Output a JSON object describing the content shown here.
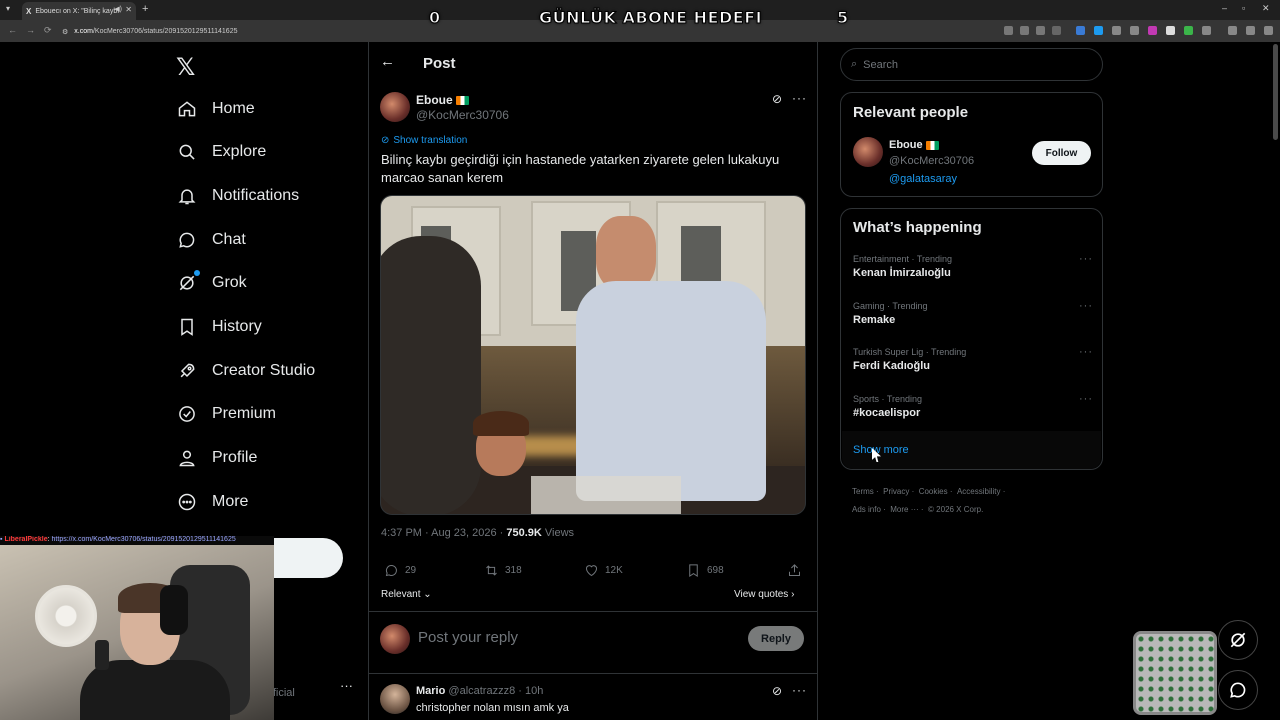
{
  "browser": {
    "tab_title": "Ebouecı on X: \"Bilinç kaybı",
    "new_tab": "+",
    "url_host": "x.com",
    "url_path": "/KocMerc30706/status/2091520129511141625",
    "win_min": "–",
    "win_max": "▫",
    "win_close": "✕"
  },
  "overlay": {
    "goal_current": "0",
    "goal_title": "GÜNLÜK ABONE HEDEFI",
    "goal_target": "5",
    "chat_user": "LiberalPickle",
    "chat_message": "https://x.com/KocMerc30706/status/2091520129511141625"
  },
  "nav": {
    "logo": "𝕏",
    "items": [
      {
        "label": "Home",
        "icon": "home-icon"
      },
      {
        "label": "Explore",
        "icon": "search-icon"
      },
      {
        "label": "Notifications",
        "icon": "bell-icon"
      },
      {
        "label": "Chat",
        "icon": "chat-icon"
      },
      {
        "label": "Grok",
        "icon": "grok-icon"
      },
      {
        "label": "History",
        "icon": "bookmark-icon"
      },
      {
        "label": "Creator Studio",
        "icon": "rocket-icon"
      },
      {
        "label": "Premium",
        "icon": "verified-icon"
      },
      {
        "label": "Profile",
        "icon": "user-icon"
      },
      {
        "label": "More",
        "icon": "more-circle-icon"
      }
    ],
    "account_suffix": "fficial",
    "account_more": "···"
  },
  "post": {
    "header_title": "Post",
    "author_name": "Eboue",
    "author_handle": "@KocMerc30706",
    "show_translation": "Show translation",
    "text": "Bilinç kaybı geçirdiği için hastanede yatarken ziyarete gelen lukakuyu marcao sanan kerem",
    "time": "4:37 PM · Aug 23, 2026 · ",
    "views_count": "750.9K",
    "views_label": " Views",
    "stats": {
      "replies": "29",
      "reposts": "318",
      "likes": "12K",
      "bookmarks": "698"
    },
    "sort_label": "Relevant",
    "view_quotes": "View quotes",
    "reply_placeholder": "Post your reply",
    "reply_button": "Reply"
  },
  "comment": {
    "name": "Mario",
    "handle": "@alcatrazzz8",
    "time": "· 10h",
    "text": "christopher nolan mısın amk ya"
  },
  "sidebar": {
    "search_placeholder": "Search",
    "relevant_title": "Relevant people",
    "person": {
      "name": "Eboue",
      "handle": "@KocMerc30706",
      "bio": "@galatasaray",
      "follow": "Follow"
    },
    "happening_title": "What’s happening",
    "trends": [
      {
        "meta": "Entertainment · Trending",
        "name": "Kenan İmirzalıoğlu"
      },
      {
        "meta": "Gaming · Trending",
        "name": "Remake"
      },
      {
        "meta": "Turkish Super Lig · Trending",
        "name": "Ferdi Kadıoğlu"
      },
      {
        "meta": "Sports · Trending",
        "name": "#kocaelispor"
      }
    ],
    "show_more": "Show more",
    "footer_row1": [
      "Terms",
      "Privacy",
      "Cookies",
      "Accessibility"
    ],
    "footer_row2": [
      "Ads info",
      "More ···",
      "© 2026 X Corp."
    ]
  },
  "colors": {
    "accent": "#1d9bf0",
    "bg": "#000000",
    "border": "#2f3336",
    "muted": "#71767b"
  }
}
